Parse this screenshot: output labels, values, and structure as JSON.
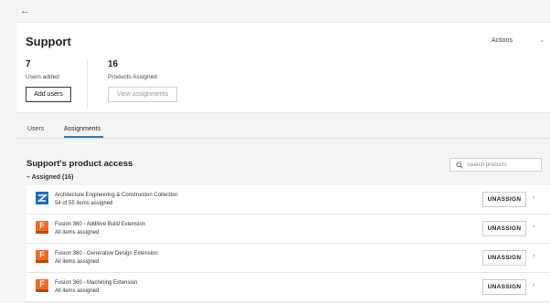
{
  "header": {
    "back_icon": "back-arrow-icon",
    "title": "Support",
    "actions_label": "Actions"
  },
  "stats": {
    "users_count": "7",
    "users_label": "Users added",
    "add_users_label": "Add users",
    "products_count": "16",
    "products_label": "Products Assigned",
    "view_assignments_label": "View assignments"
  },
  "tabs": [
    {
      "label": "Users",
      "active": false
    },
    {
      "label": "Assignments",
      "active": true
    }
  ],
  "product_access": {
    "title": "Support's product access",
    "search_placeholder": "Search products",
    "assigned_header": "– Assigned (16)",
    "unassign_label": "UNASSIGN",
    "items": [
      {
        "name": "Architecture Engineering & Construction Collection",
        "status": "54 of 55 items assigned",
        "icon": "aec-collection-icon"
      },
      {
        "name": "Fusion 360 - Additive Build Extension",
        "status": "All items assigned",
        "icon": "fusion-icon"
      },
      {
        "name": "Fusion 360 - Generative Design Extension",
        "status": "All items assigned",
        "icon": "fusion-icon"
      },
      {
        "name": "Fusion 360 - Machining Extension",
        "status": "All items assigned",
        "icon": "fusion-icon"
      }
    ]
  },
  "colors": {
    "accent": "#2a7fbf",
    "fusion_orange": "#f26a21",
    "aec_blue": "#1b6fc0"
  }
}
